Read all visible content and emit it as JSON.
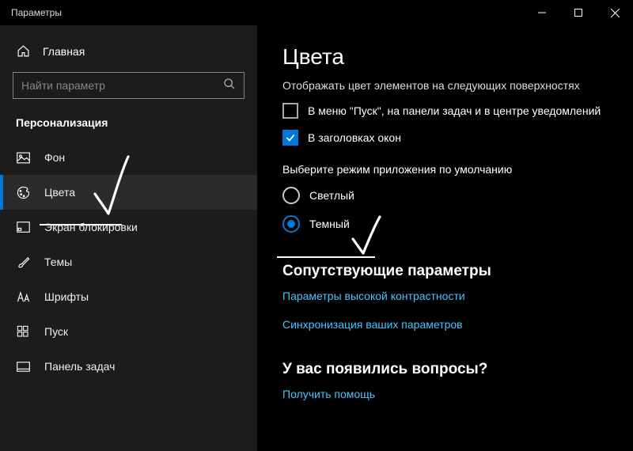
{
  "window": {
    "title": "Параметры"
  },
  "sidebar": {
    "home": "Главная",
    "search_placeholder": "Найти параметр",
    "section": "Персонализация",
    "items": [
      {
        "label": "Фон"
      },
      {
        "label": "Цвета"
      },
      {
        "label": "Экран блокировки"
      },
      {
        "label": "Темы"
      },
      {
        "label": "Шрифты"
      },
      {
        "label": "Пуск"
      },
      {
        "label": "Панель задач"
      }
    ]
  },
  "content": {
    "title": "Цвета",
    "surfaces_heading": "Отображать цвет элементов на следующих поверхностях",
    "check1": "В меню \"Пуск\", на панели задач и в центре уведомлений",
    "check2": "В заголовках окон",
    "mode_heading": "Выберите режим приложения по умолчанию",
    "mode_light": "Светлый",
    "mode_dark": "Темный",
    "related_heading": "Сопутствующие параметры",
    "link_contrast": "Параметры высокой контрастности",
    "link_sync": "Синхронизация ваших параметров",
    "questions_heading": "У вас появились вопросы?",
    "link_help": "Получить помощь"
  }
}
